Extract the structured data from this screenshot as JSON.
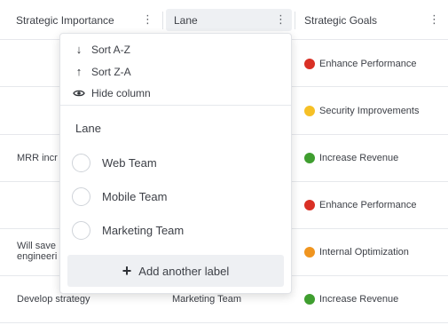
{
  "columns": {
    "strategic_importance": "Strategic Importance",
    "lane": "Lane",
    "strategic_goals": "Strategic Goals",
    "menu_icon": "more-vertical-icon"
  },
  "rows": [
    {
      "importance": "",
      "lane": "",
      "goal": "Enhance Performance",
      "goal_color": "#d93025"
    },
    {
      "importance": "",
      "lane": "",
      "goal": "Security Improvements",
      "goal_color": "#f6c026"
    },
    {
      "importance": "MRR incr",
      "lane": "",
      "goal": "Increase Revenue",
      "goal_color": "#3f9e2f"
    },
    {
      "importance": "",
      "lane": "",
      "goal": "Enhance Performance",
      "goal_color": "#d93025"
    },
    {
      "importance": "Will save\nengineeri",
      "lane": "",
      "goal": "Internal Optimization",
      "goal_color": "#f0951f"
    },
    {
      "importance": "Develop strategy",
      "lane": "Marketing Team",
      "goal": "Increase Revenue",
      "goal_color": "#3f9e2f"
    }
  ],
  "popup": {
    "sort_az": "Sort A-Z",
    "sort_za": "Sort Z-A",
    "hide_column": "Hide column",
    "section_title": "Lane",
    "options": [
      "Web Team",
      "Mobile Team",
      "Marketing Team"
    ],
    "add_label": "Add another label"
  }
}
